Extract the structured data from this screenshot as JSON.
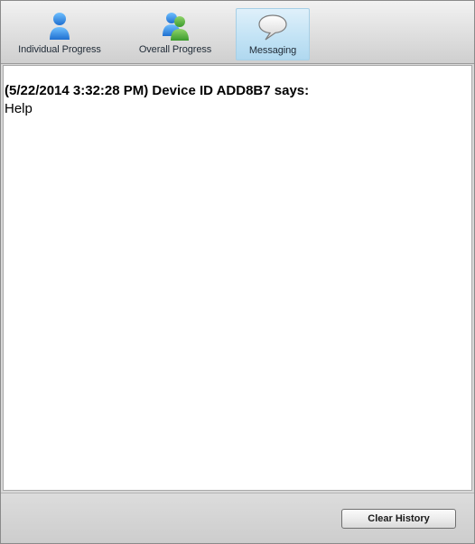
{
  "toolbar": {
    "tabs": [
      {
        "label": "Individual Progress",
        "icon": "person-icon",
        "selected": false
      },
      {
        "label": "Overall Progress",
        "icon": "group-icon",
        "selected": false
      },
      {
        "label": "Messaging",
        "icon": "speech-bubble-icon",
        "selected": true
      }
    ]
  },
  "messages": [
    {
      "header": "(5/22/2014 3:32:28 PM) Device ID ADD8B7 says:",
      "body": "Help"
    }
  ],
  "footer": {
    "clear_history_label": "Clear History"
  },
  "colors": {
    "selected_tab": "#c3e3f5",
    "person_icon": "#2f8ee0",
    "group_icon_front": "#4caa3c",
    "group_icon_back": "#2f8ee0"
  }
}
